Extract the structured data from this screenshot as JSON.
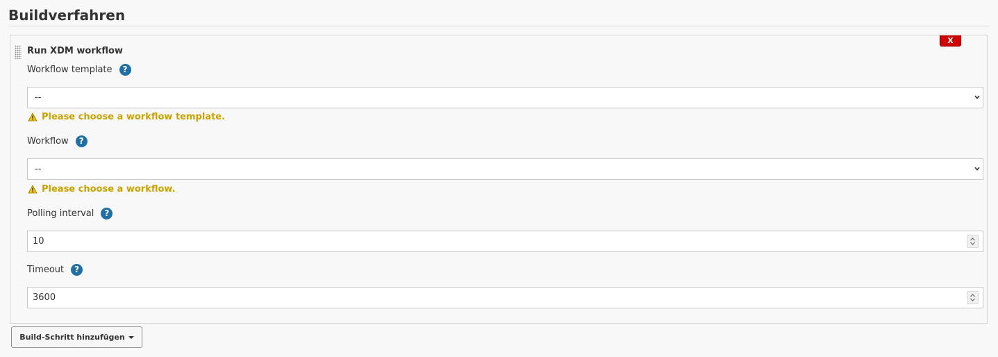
{
  "section": {
    "title": "Buildverfahren"
  },
  "step": {
    "title": "Run XDM workflow",
    "delete_label": "X",
    "fields": {
      "workflow_template": {
        "label": "Workflow template",
        "value": "--",
        "warning": "Please choose a workflow template."
      },
      "workflow": {
        "label": "Workflow",
        "value": "--",
        "warning": "Please choose a workflow."
      },
      "polling_interval": {
        "label": "Polling interval",
        "value": "10"
      },
      "timeout": {
        "label": "Timeout",
        "value": "3600"
      }
    }
  },
  "help_icon_text": "?",
  "add_step_button": {
    "label": "Build-Schritt hinzufügen"
  },
  "colors": {
    "warning": "#c9a400",
    "help": "#1f6fa8",
    "delete": "#d10000"
  },
  "icons": [
    "drag-handle-icon",
    "help-icon",
    "warning-icon",
    "chevron-down-icon",
    "spinner-icon",
    "caret-down-icon"
  ]
}
